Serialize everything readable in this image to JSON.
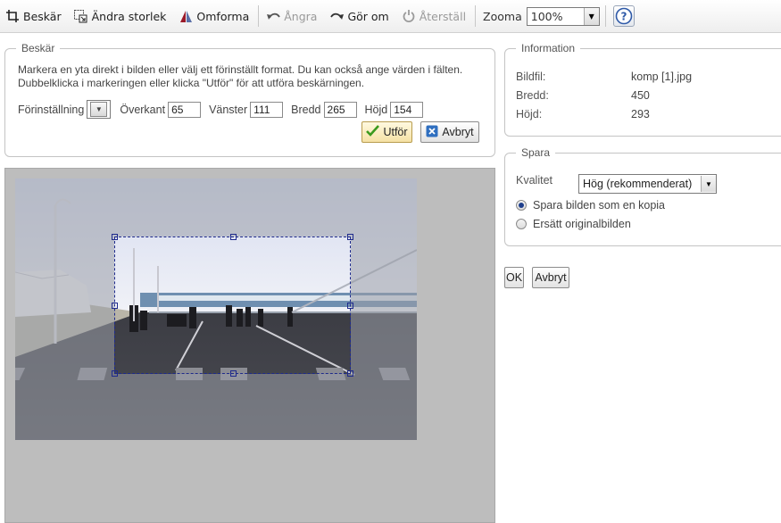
{
  "toolbar": {
    "crop_label": "Beskär",
    "resize_label": "Ändra storlek",
    "transform_label": "Omforma",
    "undo_label": "Ångra",
    "redo_label": "Gör om",
    "reset_label": "Återställ",
    "zoom_label": "Zooma",
    "zoom_value": "100%",
    "help_label": "?"
  },
  "crop": {
    "legend": "Beskär",
    "description_line1": "Markera en yta direkt i bilden eller välj ett förinställt format. Du kan också ange värden i fälten.",
    "description_line2": "Dubbelklicka i markeringen eller klicka \"Utför\" för att utföra beskärningen.",
    "preset_label": "Förinställning",
    "top_label": "Överkant",
    "top_value": "65",
    "left_label": "Vänster",
    "left_value": "111",
    "width_label": "Bredd",
    "width_value": "265",
    "height_label": "Höjd",
    "height_value": "154",
    "apply_label": "Utför",
    "cancel_label": "Avbryt"
  },
  "info": {
    "legend": "Information",
    "file_label": "Bildfil:",
    "file_value": "komp [1].jpg",
    "width_label": "Bredd:",
    "width_value": "450",
    "height_label": "Höjd:",
    "height_value": "293"
  },
  "save": {
    "legend": "Spara",
    "quality_label": "Kvalitet",
    "quality_value": "Hög (rekommenderat)",
    "option_copy": "Spara bilden som en kopia",
    "option_replace": "Ersätt originalbilden",
    "selected_option": "copy"
  },
  "dialog": {
    "ok_label": "OK",
    "cancel_label": "Avbryt"
  },
  "colors": {
    "selection_border": "#1e2a8c",
    "canvas_background": "#bdbdbd",
    "accept_check": "#3a9a1e",
    "cancel_x": "#2f6fc0"
  }
}
